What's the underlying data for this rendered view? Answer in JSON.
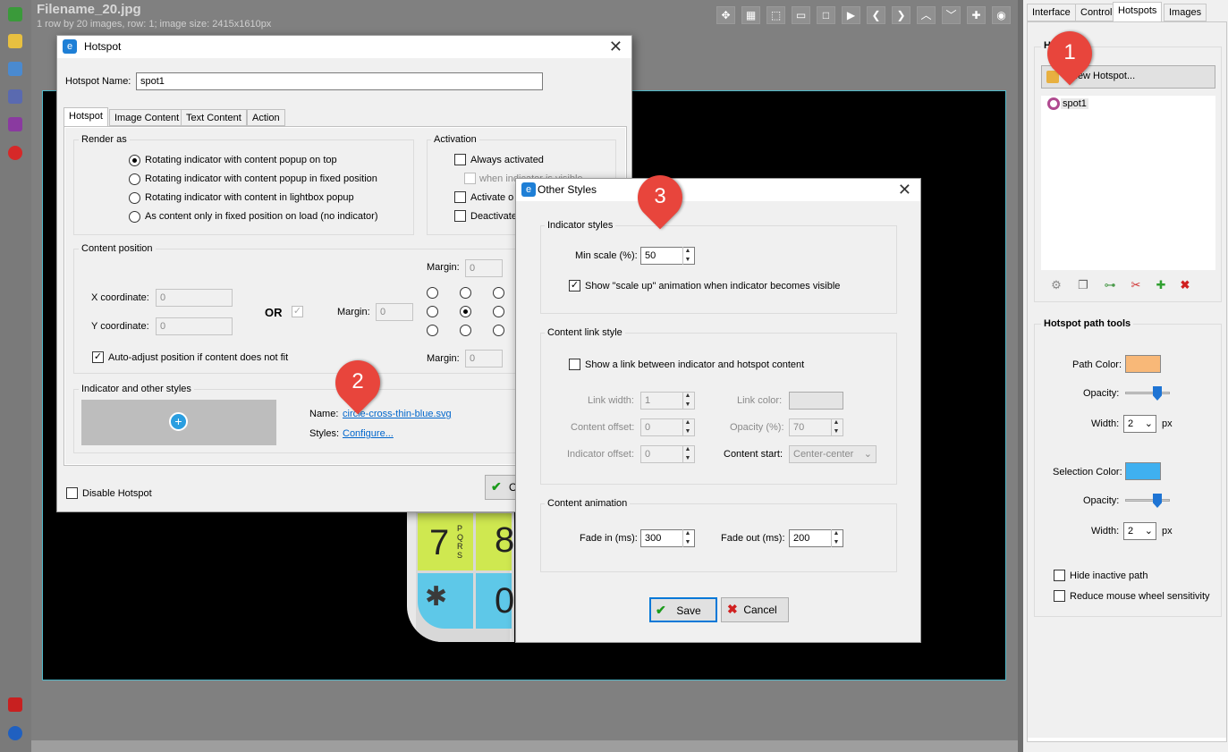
{
  "viewer": {
    "file_title": "Filename_20.jpg",
    "file_info": "1 row by 20 images, row: 1; image size: 2415x1610px"
  },
  "toolbar_icons": [
    "move-icon",
    "grid-icon",
    "select-icon",
    "filmstrip-icon",
    "frame-icon",
    "play-icon",
    "prev-icon",
    "next-icon",
    "up-icon",
    "down-icon",
    "zoom-in-icon",
    "target-icon"
  ],
  "panel": {
    "tabs": [
      "Interface",
      "Control",
      "Hotspots",
      "Images"
    ],
    "active_tab": "Hotspots",
    "hotspots_group": "Ho",
    "new_hotspot": "New Hotspot...",
    "hotspot_list": [
      "spot1"
    ],
    "path_tools": {
      "title": "Hotspot path tools",
      "path_color_label": "Path Color:",
      "path_color": "#f8b878",
      "opacity_label": "Opacity:",
      "width_label": "Width:",
      "path_width": "2",
      "px": "px",
      "selection_color_label": "Selection Color:",
      "selection_color": "#3fb0f0",
      "selection_width": "2",
      "hide_inactive": "Hide inactive path",
      "reduce_wheel": "Reduce mouse wheel sensitivity"
    }
  },
  "hotspot_dialog": {
    "title": "Hotspot",
    "name_label": "Hotspot Name:",
    "name_value": "spot1",
    "tabs": [
      "Hotspot",
      "Image Content",
      "Text Content",
      "Action"
    ],
    "render_as": {
      "title": "Render as",
      "options": [
        "Rotating indicator with content popup on top",
        "Rotating indicator with content popup in fixed position",
        "Rotating indicator with content in lightbox popup",
        "As content only in fixed position on load (no indicator)"
      ]
    },
    "activation": {
      "title": "Activation",
      "always": "Always activated",
      "when_visible": "when indicator is visible",
      "activate_on": "Activate o",
      "deactivate": "Deactivate"
    },
    "content_position": {
      "title": "Content position",
      "margin_label": "Margin:",
      "margin_value": "0",
      "x_label": "X coordinate:",
      "x_value": "0",
      "y_label": "Y coordinate:",
      "y_value": "0",
      "or": "OR",
      "auto_adjust": "Auto-adjust position if content does not fit"
    },
    "indicator": {
      "title": "Indicator and other styles",
      "name_label": "Name:",
      "name_value": "circle-cross-thin-blue.svg",
      "styles_label": "Styles:",
      "configure": "Configure..."
    },
    "disable": "Disable Hotspot",
    "ok_partial": "O"
  },
  "styles_dialog": {
    "title": "Other Styles",
    "indicator_styles": {
      "title": "Indicator styles",
      "min_scale_label": "Min scale (%):",
      "min_scale_value": "50",
      "scale_up": "Show \"scale up\" animation when indicator becomes visible"
    },
    "link_style": {
      "title": "Content link style",
      "show_link": "Show a link between indicator and hotspot content",
      "link_width_label": "Link width:",
      "link_width": "1",
      "link_color_label": "Link color:",
      "content_offset_label": "Content offset:",
      "content_offset": "0",
      "opacity_label": "Opacity (%):",
      "opacity": "70",
      "indicator_offset_label": "Indicator offset:",
      "indicator_offset": "0",
      "content_start_label": "Content start:",
      "content_start": "Center-center"
    },
    "animation": {
      "title": "Content animation",
      "fade_in_label": "Fade in (ms):",
      "fade_in": "300",
      "fade_out_label": "Fade out (ms):",
      "fade_out": "200"
    },
    "save": "Save",
    "cancel": "Cancel"
  },
  "callouts": [
    "1",
    "2",
    "3"
  ],
  "phone_keys": {
    "k7": "7",
    "k8": "8",
    "k0": "0",
    "pqrs": "PQRS"
  }
}
